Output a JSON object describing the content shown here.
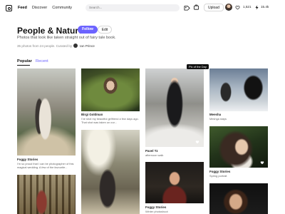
{
  "nav": {
    "links": [
      "Feed",
      "Discover",
      "Community"
    ],
    "search_placeholder": "Search...",
    "upload_label": "Upload",
    "stats": [
      "1,521",
      "15.4k"
    ]
  },
  "header": {
    "title": "People & Nature",
    "follow_label": "Follow",
    "edit_label": "Edit",
    "description": "Photos that look like taken straight out of fairy tale book.",
    "meta_prefix": "35 photos from 24 people. Curated by",
    "curator": "Ian Prince"
  },
  "tabs": [
    "Popular",
    "Recent"
  ],
  "tooltip": "Pic of the Day",
  "photos": [
    {
      "author": "Foggy Stories",
      "caption": "I'm so proud that I can be photographer of this magical wedding. A few of the favourite..."
    },
    {
      "author": "Birgi Goldman",
      "caption": "I've shot my beautiful girlfriend a few days ago. That shot was taken on our..."
    },
    {
      "author": "Pavel Tz",
      "caption": "afternoon walk"
    },
    {
      "author": "Meesha",
      "caption": "Meshga stays"
    },
    {
      "author": "Foggy Stories",
      "caption": "Spring portrait"
    },
    {
      "author": "Foggy Stories",
      "caption": "Winter photoshoot"
    }
  ],
  "colors": {
    "accent": "#6c63ff",
    "text": "#111111",
    "muted": "#888888"
  },
  "icons": [
    "logo-icon",
    "notification-icon",
    "collection-icon",
    "heart-icon",
    "lightning-icon",
    "bell-icon"
  ]
}
